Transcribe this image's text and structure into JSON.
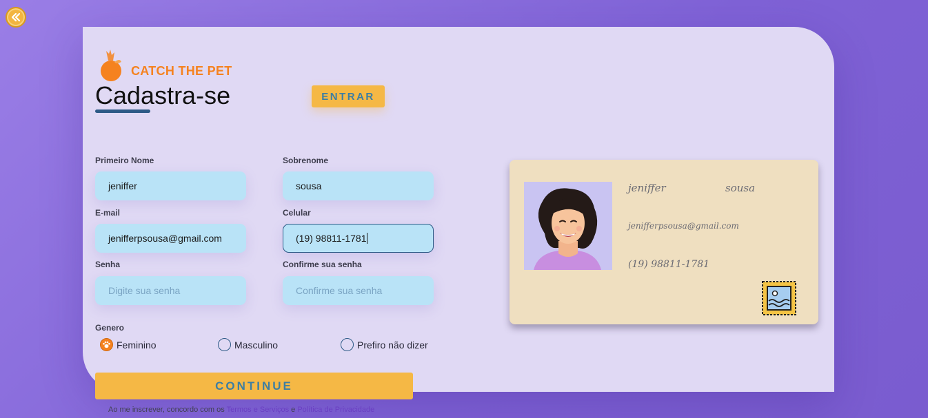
{
  "brand": {
    "name": "CATCH THE PET"
  },
  "page": {
    "title": "Cadastra-se"
  },
  "header": {
    "login_label": "ENTRAR"
  },
  "form": {
    "first_name": {
      "label": "Primeiro Nome",
      "value": "jeniffer"
    },
    "last_name": {
      "label": "Sobrenome",
      "value": "sousa"
    },
    "email": {
      "label": "E-mail",
      "value": "jenifferpsousa@gmail.com"
    },
    "phone": {
      "label": "Celular",
      "value": "(19) 98811-1781"
    },
    "password": {
      "label": "Senha",
      "placeholder": "Digite sua senha"
    },
    "confirm_password": {
      "label": "Confirme sua senha",
      "placeholder": "Confirme sua senha"
    },
    "gender": {
      "label": "Genero",
      "options": [
        {
          "label": "Feminino",
          "selected": true
        },
        {
          "label": "Masculino",
          "selected": false
        },
        {
          "label": "Prefiro não dizer",
          "selected": false
        }
      ]
    },
    "continue_label": "CONTINUE",
    "terms": {
      "prefix": "Ao me inscrever, concordo com os",
      "terms_link": "Termos e Serviços",
      "conjunction": "e",
      "privacy_link": "Política de Privacidade"
    }
  },
  "id_card": {
    "first_name": "jeniffer",
    "last_name": "sousa",
    "email": "jenifferpsousa@gmail.com",
    "phone": "(19) 98811-1781"
  },
  "icons": {
    "back": "double-chevron-left-icon",
    "brand": "pet-logo-icon",
    "avatar": "user-avatar-illustration",
    "stamp": "postage-stamp-icon",
    "radio_checked": "paw-icon"
  },
  "colors": {
    "accent": "#f5b845",
    "brand": "#f5821f",
    "field": "#b9e3f7",
    "button_text": "#3d7ea3",
    "card": "#efdfc0"
  }
}
